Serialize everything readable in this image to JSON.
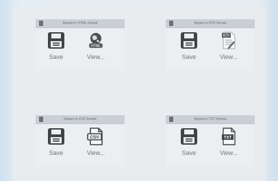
{
  "cards": [
    {
      "title": "Report in HTML format",
      "save_label": "Save",
      "view_label": "View...",
      "view_icon": "html-globe-icon"
    },
    {
      "title": "Report in RTF format",
      "save_label": "Save",
      "view_label": "View...",
      "view_icon": "rtf-document-icon"
    },
    {
      "title": "Report in CSV format",
      "save_label": "Save",
      "view_label": "View...",
      "view_icon": "csv-file-icon"
    },
    {
      "title": "Report in TXT format",
      "save_label": "Save",
      "view_label": "View...",
      "view_icon": "txt-file-icon"
    }
  ],
  "icon_text": {
    "html": "HTML",
    "rtf": "RTF",
    "csv": "CSV",
    "txt": "TXT"
  },
  "colors": {
    "icon": "#3f4448",
    "header": "#c9cfd4",
    "label": "#6f7479"
  }
}
